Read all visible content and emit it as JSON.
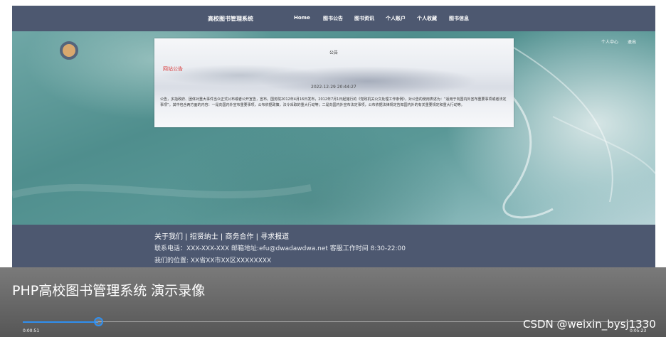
{
  "navbar": {
    "brand": "高校图书管理系统",
    "items": [
      "Home",
      "图书公告",
      "图书资讯",
      "个人账户",
      "个人收藏",
      "图书信息"
    ]
  },
  "user_links": [
    "个人中心",
    "退出"
  ],
  "notice": {
    "title": "公告",
    "heading": "网站公告",
    "date": "2022-12-29 20:44:27",
    "body": "公告，多指政府、团体对重大事件当众正式公布或者公开宣告，宣布。国务院2012年4月16日发布，2012年7月1日起施行的《党政机关公文处理工作条例》，对公告的使用表述为：“适用于向国内外宣布重要事项或者法定事项”。其中包含两方面的内容：一是向国内外宣布重要事项，公布依据政策，法令采取的重大行动等；二是向国内外宣布法定事项，公布依据法律规定告知国内外的有关重要规定和重大行动等。"
  },
  "footer": {
    "links": "关于我们 | 招贤纳士 | 商务合作 | 寻求报道",
    "contact": "联系电话：XXX-XXX-XXX 邮箱地址:efu@dwadawdwa.net 客服工作时间 8:30-22:00",
    "address": "我们的位置: XX省XX市XX区XXXXXXXX"
  },
  "video": {
    "title": "PHP高校图书管理系统 演示录像",
    "current_time": "0:00:51",
    "total_time": "0:05:23",
    "progress": 0.12
  },
  "watermark": "CSDN @weixin_bysj1330",
  "colors": {
    "nav_bg": "#4d5870",
    "notice_heading": "#d93c3c",
    "progress": "#2f8ff0"
  }
}
